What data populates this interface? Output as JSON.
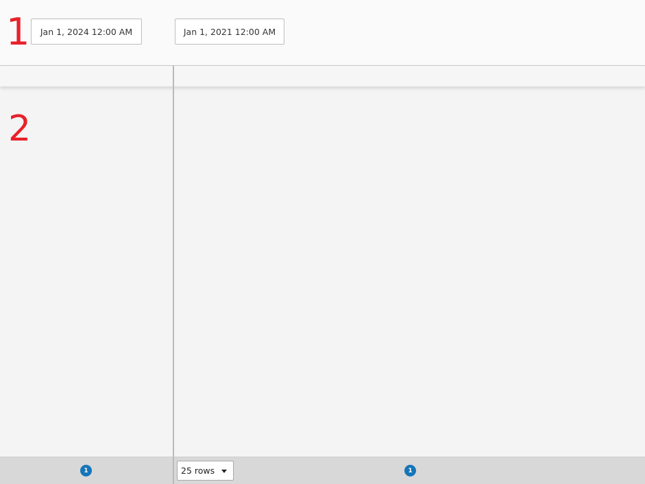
{
  "annotations": {
    "marker_1": "1",
    "marker_2": "2"
  },
  "toolbar": {
    "start_date": "Jan 1, 2024 12:00 AM",
    "end_date": "Jan 1, 2021 12:00 AM"
  },
  "footer": {
    "left_page": "1",
    "right_page": "1",
    "rows_select": {
      "selected": "25 rows"
    }
  },
  "colors": {
    "annotation": "#e8212a",
    "page_badge": "#1575b8",
    "footer_bg": "#d8d8d8",
    "pane_bg": "#f4f4f4"
  }
}
